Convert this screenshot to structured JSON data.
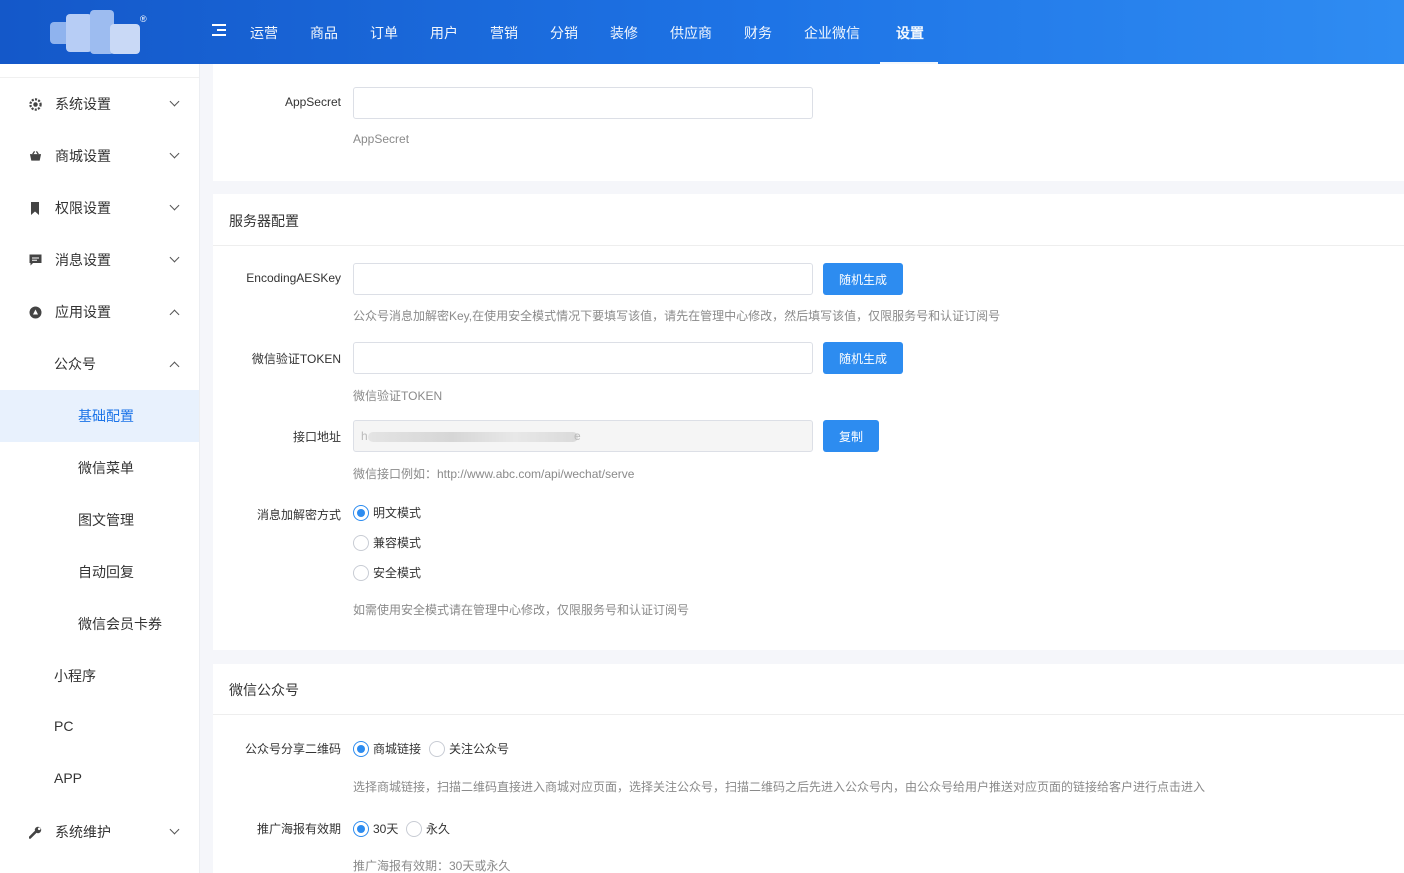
{
  "header": {
    "logo_mark": "®",
    "nav": [
      "运营",
      "商品",
      "订单",
      "用户",
      "营销",
      "分销",
      "装修",
      "供应商",
      "财务",
      "企业微信",
      "设置"
    ],
    "active_nav": "设置"
  },
  "sidebar": {
    "items": [
      {
        "label": "系统设置",
        "icon": "gear-icon",
        "expanded": false
      },
      {
        "label": "商城设置",
        "icon": "shop-basket-icon",
        "expanded": false
      },
      {
        "label": "权限设置",
        "icon": "bookmark-icon",
        "expanded": false
      },
      {
        "label": "消息设置",
        "icon": "message-icon",
        "expanded": false
      },
      {
        "label": "应用设置",
        "icon": "app-compass-icon",
        "expanded": true
      },
      {
        "label": "公众号",
        "expanded": true
      },
      {
        "label": "基础配置",
        "active": true
      },
      {
        "label": "微信菜单"
      },
      {
        "label": "图文管理"
      },
      {
        "label": "自动回复"
      },
      {
        "label": "微信会员卡券"
      },
      {
        "label": "小程序"
      },
      {
        "label": "PC"
      },
      {
        "label": "APP"
      },
      {
        "label": "系统维护",
        "icon": "wrench-icon",
        "expanded": false
      }
    ]
  },
  "top_card": {
    "appsecret_label": "AppSecret",
    "appsecret_value": "",
    "appsecret_hint": "AppSecret"
  },
  "server_card": {
    "title": "服务器配置",
    "aeskey": {
      "label": "EncodingAESKey",
      "value": "",
      "button": "随机生成",
      "hint": "公众号消息加解密Key,在使用安全模式情况下要填写该值，请先在管理中心修改，然后填写该值，仅限服务号和认证订阅号"
    },
    "token": {
      "label": "微信验证TOKEN",
      "value": "",
      "button": "随机生成",
      "hint": "微信验证TOKEN"
    },
    "url": {
      "label": "接口地址",
      "visible_start": "h",
      "visible_end": "e",
      "button": "复制",
      "hint": "微信接口例如：http://www.abc.com/api/wechat/serve"
    },
    "encrypt": {
      "label": "消息加解密方式",
      "options": [
        "明文模式",
        "兼容模式",
        "安全模式"
      ],
      "selected": "明文模式",
      "hint": "如需使用安全模式请在管理中心修改，仅限服务号和认证订阅号"
    }
  },
  "wechat_card": {
    "title": "微信公众号",
    "qrcode": {
      "label": "公众号分享二维码",
      "options": [
        "商城链接",
        "关注公众号"
      ],
      "selected": "商城链接",
      "hint": "选择商城链接，扫描二维码直接进入商城对应页面，选择关注公众号，扫描二维码之后先进入公众号内，由公众号给用户推送对应页面的链接给客户进行点击进入"
    },
    "poster": {
      "label": "推广海报有效期",
      "options": [
        "30天",
        "永久"
      ],
      "selected": "30天",
      "hint": "推广海报有效期：30天或永久"
    }
  },
  "colors": {
    "primary": "#2d8cf0",
    "header_from": "#1458c9",
    "header_to": "#2f8cf2",
    "sidebar_active_bg": "#e8f1fd"
  }
}
